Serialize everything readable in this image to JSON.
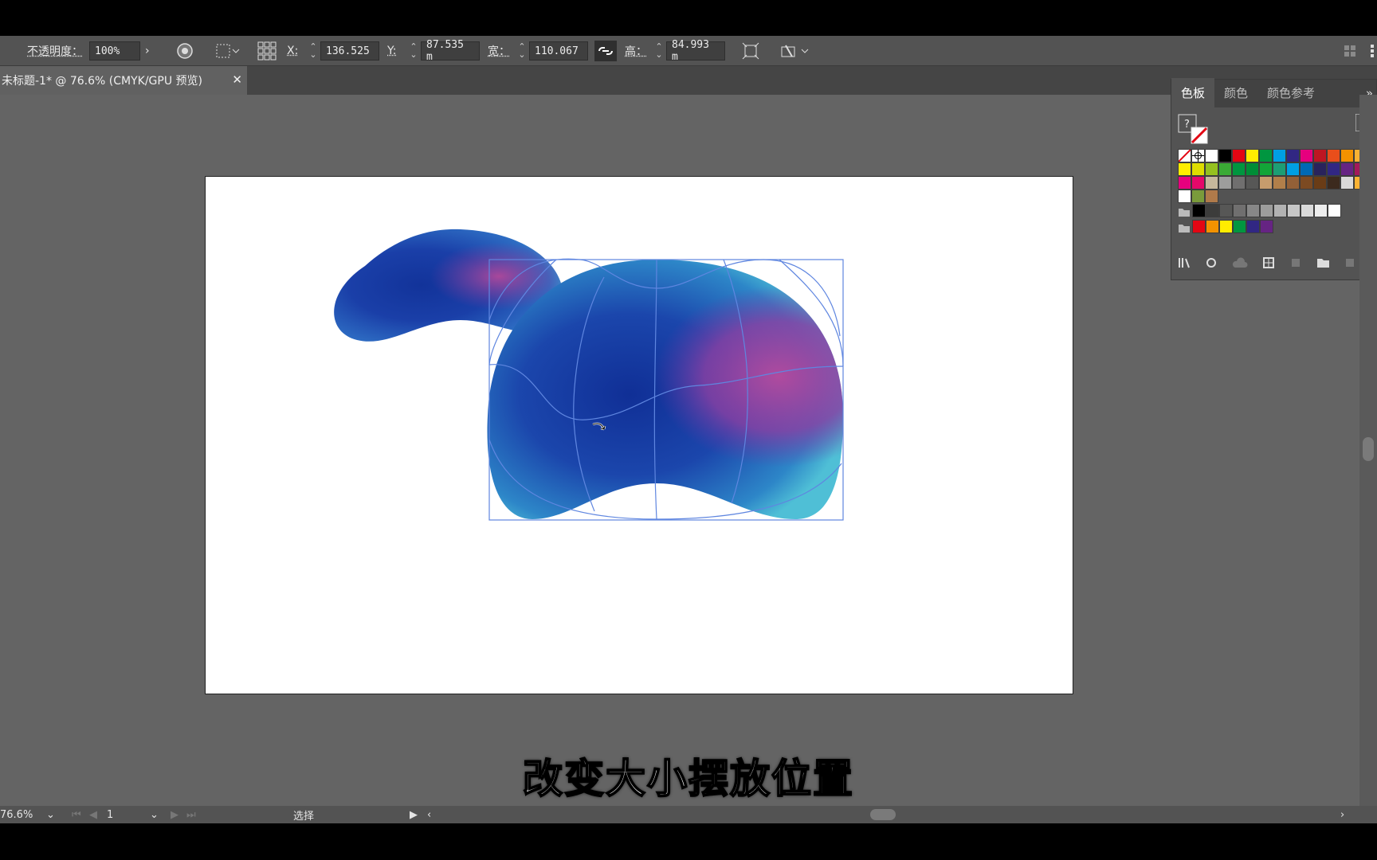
{
  "control_bar": {
    "opacity_label": "不透明度：",
    "opacity_value": "100%",
    "x_label": "X:",
    "x_value": "136.525",
    "y_label": "Y:",
    "y_value": "87.535 m",
    "width_label": "宽：",
    "width_value": "110.067",
    "height_label": "高：",
    "height_value": "84.993 m"
  },
  "document_tab": {
    "title": "未标题-1* @ 76.6% (CMYK/GPU 预览)",
    "close": "✕"
  },
  "swatches_panel": {
    "tabs": [
      "色板",
      "颜色",
      "颜色参考"
    ],
    "active_tab": "色板",
    "row1": [
      "#ffffff",
      "#ffffff",
      "#ffffff",
      "#000000",
      "#e30613",
      "#ffed00",
      "#009640",
      "#009fe3",
      "#312783",
      "#e6007e",
      "#be1622",
      "#e94e1b",
      "#f39200",
      "#f9b233"
    ],
    "row2": [
      "#ffed00",
      "#dedc00",
      "#95c11f",
      "#3aaa35",
      "#00963f",
      "#008d36",
      "#13a538",
      "#1d9e74",
      "#009fe3",
      "#0069b4",
      "#29235c",
      "#312783",
      "#662483",
      "#a3195b"
    ],
    "row3": [
      "#e6007e",
      "#e5086a",
      "#c6b89c",
      "#9d9d9c",
      "#706f6f",
      "#575756",
      "#c69c6d",
      "#b17f4a",
      "#936037",
      "#7c4a22",
      "#6a3c16",
      "#3c2a1e",
      "#d9d9d9",
      "#f9b233"
    ],
    "row4_gray": [
      "#000000",
      "#3c3c3b",
      "#575756",
      "#706f6f",
      "#878787",
      "#9d9d9c",
      "#b2b2b2",
      "#c6c6c6",
      "#dadada",
      "#ededed",
      "#ffffff"
    ],
    "row5_color": [
      "#e30613",
      "#f39200",
      "#ffed00",
      "#009640",
      "#312783",
      "#662483"
    ]
  },
  "status_bar": {
    "zoom": "76.6%",
    "page": "1",
    "tool": "选择"
  },
  "subtitle": "改变大小摆放位置"
}
